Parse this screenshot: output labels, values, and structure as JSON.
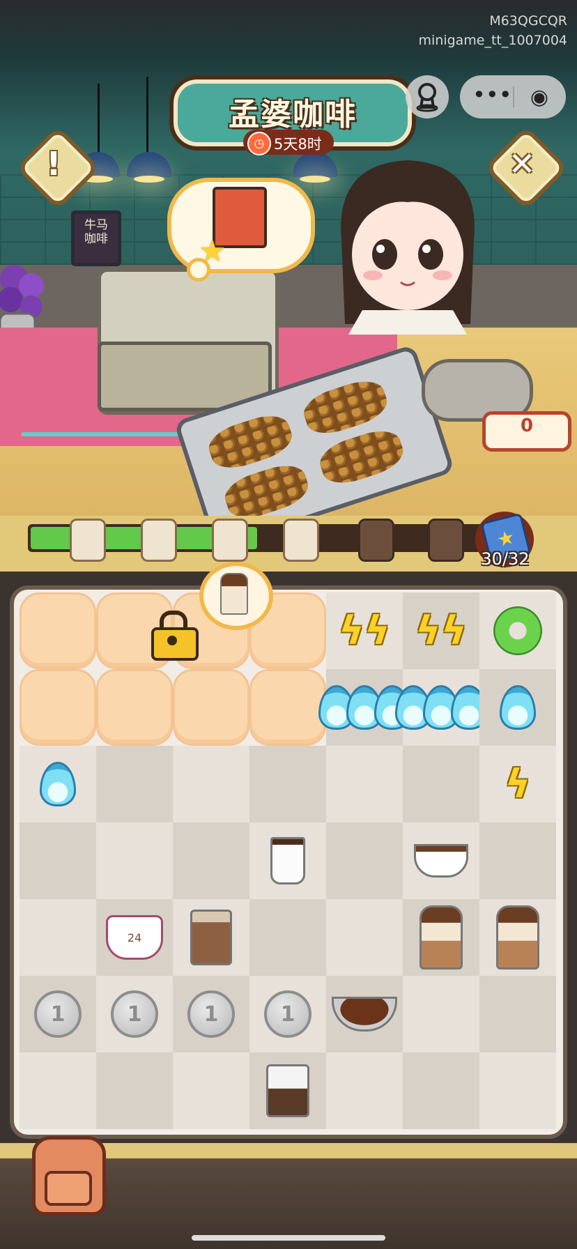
{
  "header": {
    "title": "孟婆咖啡",
    "timer": "5天8时",
    "timer_icon": "clock-icon",
    "mini_id_line1": "M63QGCQR",
    "mini_id_line2": "minigame_tt_1007004"
  },
  "capsule": {
    "avatar_icon": "user-icon",
    "menu_glyph": "•••",
    "close_glyph": "◉"
  },
  "buttons": {
    "info_glyph": "!",
    "close_glyph": "✕"
  },
  "scene": {
    "sign_text_line1": "牛马",
    "sign_text_line2": "咖啡"
  },
  "counter": {
    "coin_value": "0"
  },
  "progress": {
    "fraction": 0.47,
    "count": "30/32",
    "milestones": [
      {
        "state": "unlocked"
      },
      {
        "state": "unlocked"
      },
      {
        "state": "unlocked"
      },
      {
        "state": "unlocked"
      },
      {
        "state": "locked"
      },
      {
        "state": "locked"
      }
    ]
  },
  "board": {
    "columns": 7,
    "rows": 7,
    "cells": [
      [
        "cloud",
        "cloud",
        "cloud",
        "cloud",
        "bolt2",
        "bolt2b",
        "donut"
      ],
      [
        "cloud",
        "cloud",
        "cloud",
        "cloud",
        "flame3",
        "flame3",
        "flame"
      ],
      [
        "flame",
        "",
        "",
        "",
        "",
        "",
        "bolt"
      ],
      [
        "",
        "",
        "",
        "cup",
        "",
        "teacup",
        ""
      ],
      [
        "",
        "latte",
        "glass",
        "",
        "",
        "parfait",
        "parfait2"
      ],
      [
        "coin1",
        "coin1",
        "coin1",
        "coin1",
        "bowl",
        "",
        ""
      ],
      [
        "",
        "",
        "",
        "bag",
        "",
        "",
        ""
      ]
    ],
    "coin_label": "1",
    "latte_label": "24"
  },
  "colors": {
    "progress_fill": "#62c94a",
    "title_plate": "#4aa99a",
    "accent_red": "#b9432c"
  }
}
